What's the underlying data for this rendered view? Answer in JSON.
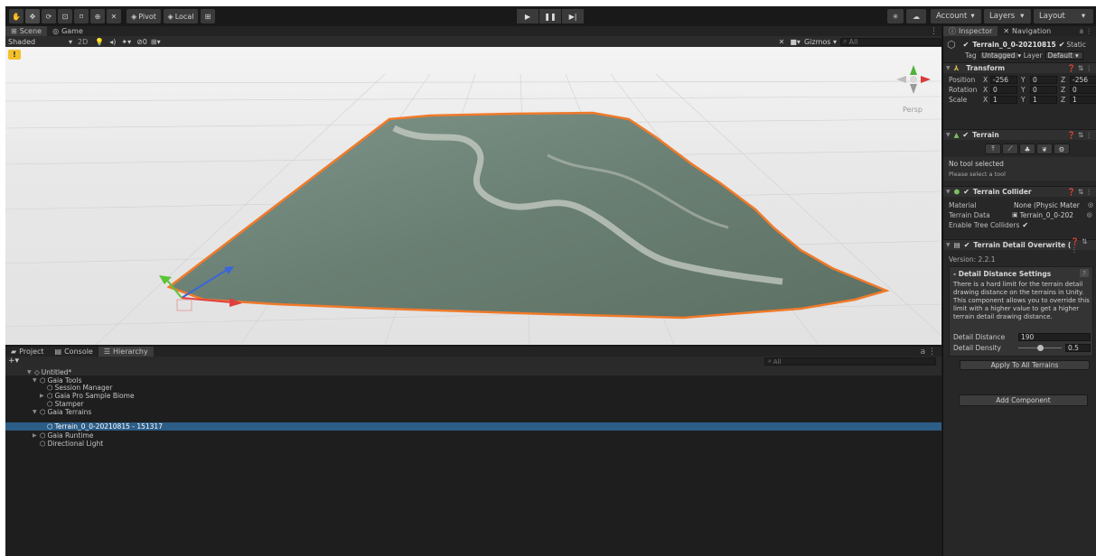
{
  "toolbar": {
    "pivot": "Pivot",
    "local": "Local",
    "account": "Account",
    "layers": "Layers",
    "layout": "Layout"
  },
  "scene_tabs": [
    "Scene",
    "Game"
  ],
  "scene_options": {
    "shading": "Shaded",
    "mode_2d": "2D",
    "effects_count": "0",
    "gizmos": "Gizmos",
    "search_placeholder": "All"
  },
  "scene": {
    "projection": "Persp"
  },
  "bottom_tabs": [
    "Project",
    "Console",
    "Hierarchy"
  ],
  "hierarchy": {
    "search_placeholder": "All",
    "items": [
      {
        "label": "Untitled*",
        "depth": 0,
        "arrow": "▼",
        "icon": "unity-scene-icon",
        "selected": false
      },
      {
        "label": "Gaia Tools",
        "depth": 1,
        "arrow": "▼",
        "icon": "gameobject-icon",
        "selected": false
      },
      {
        "label": "Session Manager",
        "depth": 2,
        "arrow": "",
        "icon": "gameobject-icon",
        "selected": false
      },
      {
        "label": "Gaia Pro Sample Biome",
        "depth": 2,
        "arrow": "▶",
        "icon": "gameobject-icon",
        "selected": false
      },
      {
        "label": "Stamper",
        "depth": 2,
        "arrow": "",
        "icon": "gameobject-icon",
        "selected": false
      },
      {
        "label": "Gaia Terrains",
        "depth": 1,
        "arrow": "▼",
        "icon": "gameobject-icon",
        "selected": false
      },
      {
        "label": "Terrain_0_0-20210815 - 151317",
        "depth": 2,
        "arrow": "",
        "icon": "gameobject-icon",
        "selected": true
      },
      {
        "label": "Gaia Runtime",
        "depth": 1,
        "arrow": "▶",
        "icon": "gameobject-icon",
        "selected": false
      },
      {
        "label": "Directional Light",
        "depth": 1,
        "arrow": "",
        "icon": "gameobject-icon",
        "selected": false
      }
    ]
  },
  "inspector": {
    "tabs": [
      "Inspector",
      "Navigation"
    ],
    "object_name": "Terrain_0_0-20210815",
    "static": "Static",
    "tag_label": "Tag",
    "tag_value": "Untagged",
    "layer_label": "Layer",
    "layer_value": "Default",
    "transform": {
      "title": "Transform",
      "position_label": "Position",
      "rotation_label": "Rotation",
      "scale_label": "Scale",
      "position": {
        "x": "-256",
        "y": "0",
        "z": "-256"
      },
      "rotation": {
        "x": "0",
        "y": "0",
        "z": "0"
      },
      "scale": {
        "x": "1",
        "y": "1",
        "z": "1"
      }
    },
    "terrain": {
      "title": "Terrain",
      "no_tool": "No tool selected",
      "please_select": "Please select a tool"
    },
    "collider": {
      "title": "Terrain Collider",
      "material_label": "Material",
      "material_value": "None (Physic Mater",
      "data_label": "Terrain Data",
      "data_value": "Terrain_0_0-202",
      "tree_label": "Enable Tree Colliders"
    },
    "detail": {
      "title": "Terrain Detail Overwrite (",
      "version": "Version: 2.2.1",
      "section": "- Detail Distance Settings",
      "help": "There is a hard limit for the terrain detail drawing distance on the terrains in Unity. This component allows you to override this limit with a higher value to get a higher terrain detail drawing distance.",
      "distance_label": "Detail Distance",
      "distance_value": "190",
      "density_label": "Detail Density",
      "density_value": "0.5",
      "density_fraction": 0.5,
      "apply_button": "Apply To All Terrains"
    },
    "add_component": "Add Component"
  },
  "colors": {
    "selection": "#2c5d87",
    "terrain_outline": "#f07a2a",
    "terrain_fill": "#6f8478"
  }
}
